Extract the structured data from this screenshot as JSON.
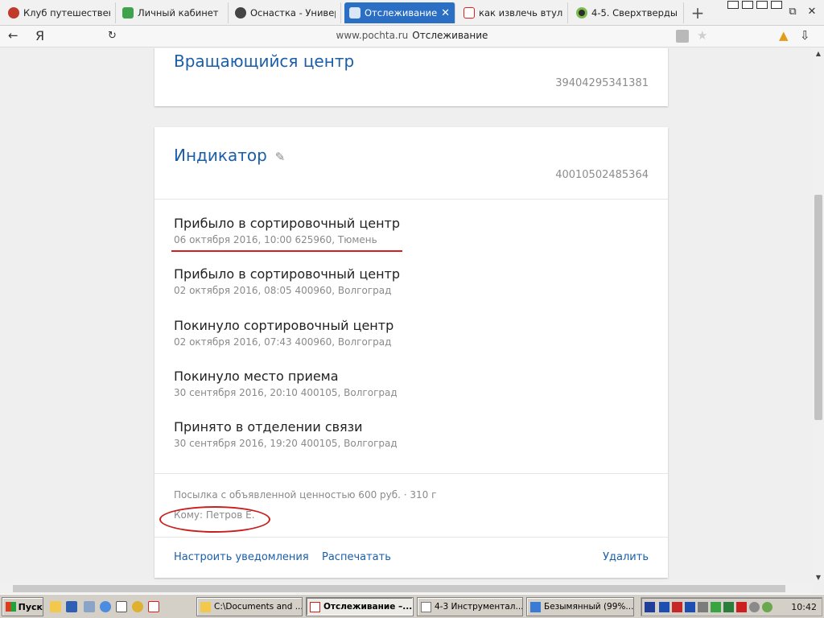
{
  "browser": {
    "tabs": [
      {
        "label": "Клуб путешествен",
        "icon": "globe-icon",
        "active": false
      },
      {
        "label": "Личный кабинет",
        "icon": "dots-icon",
        "active": false
      },
      {
        "label": "Оснастка - Универ",
        "icon": "gear-icon",
        "active": false
      },
      {
        "label": "Отслеживание",
        "icon": "post-emblem-icon",
        "active": true
      },
      {
        "label": "как извлечь втулк",
        "icon": "yandex-icon",
        "active": false
      },
      {
        "label": "4-5. Сверхтверды",
        "icon": "globe-icon",
        "active": false
      }
    ],
    "close_tab_symbol": "✕",
    "new_tab_symbol": "+",
    "back_symbol": "←",
    "yandex_symbol": "Я",
    "reload_symbol": "↻",
    "address": {
      "host": "www.pochta.ru",
      "title": "Отслеживание"
    },
    "star_symbol": "★",
    "download_symbol": "⇩",
    "warning_symbol": "▲",
    "win_restore_symbol": "⧉",
    "win_close_symbol": "✕"
  },
  "page": {
    "card1": {
      "title": "Вращающийся центр",
      "tracking": "39404295341381"
    },
    "card2": {
      "title": "Индикатор",
      "edit_symbol": "✎",
      "tracking": "40010502485364",
      "events": [
        {
          "status": "Прибыло в сортировочный центр",
          "meta": "06 октября 2016, 10:00 625960, Тюмень"
        },
        {
          "status": "Прибыло в сортировочный центр",
          "meta": "02 октября 2016, 08:05 400960, Волгоград"
        },
        {
          "status": "Покинуло сортировочный центр",
          "meta": "02 октября 2016, 07:43 400960, Волгоград"
        },
        {
          "status": "Покинуло место приема",
          "meta": "30 сентября 2016, 20:10 400105, Волгоград"
        },
        {
          "status": "Принято в отделении связи",
          "meta": "30 сентября 2016, 19:20 400105, Волгоград"
        }
      ],
      "parcel_info": "Посылка с объявленной ценностью 600 руб.  ·  310 г",
      "recipient": "Кому: Петров Е.",
      "actions": {
        "notify": "Настроить уведомления",
        "print": "Распечатать",
        "delete": "Удалить"
      }
    }
  },
  "taskbar": {
    "start_label": "Пуск",
    "items": [
      {
        "label": "C:\\Documents and ...",
        "icon": "folder-icon",
        "active": false
      },
      {
        "label": "Отслеживание –...",
        "icon": "yandex-browser-icon",
        "active": true
      },
      {
        "label": "4-3 Инструментал...",
        "icon": "document-icon",
        "active": false
      },
      {
        "label": "Безымянный (99%...",
        "icon": "image-editor-icon",
        "active": false
      }
    ],
    "clock": "10:42"
  },
  "colors": {
    "accent": "#1a5ea8",
    "active_tab": "#2b6fc4",
    "annotation_red": "#d42020"
  }
}
